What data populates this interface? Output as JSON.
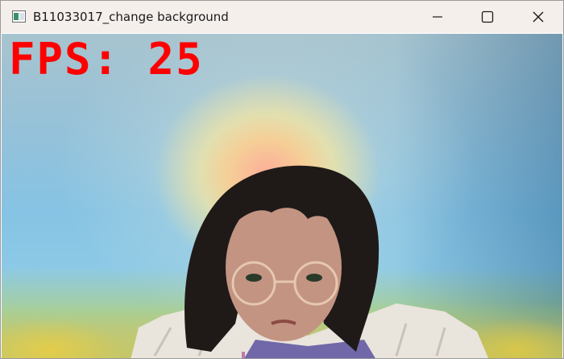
{
  "window": {
    "title": "B11033017_change background",
    "controls": {
      "minimize": "minimize",
      "maximize": "maximize",
      "close": "close"
    }
  },
  "overlay": {
    "fps_text": "FPS: 25"
  },
  "colors": {
    "fps_text": "#ff0000",
    "titlebar_bg": "#f5efec",
    "sky": "#86c3e4",
    "sun_glow": "#ffcd8c"
  }
}
